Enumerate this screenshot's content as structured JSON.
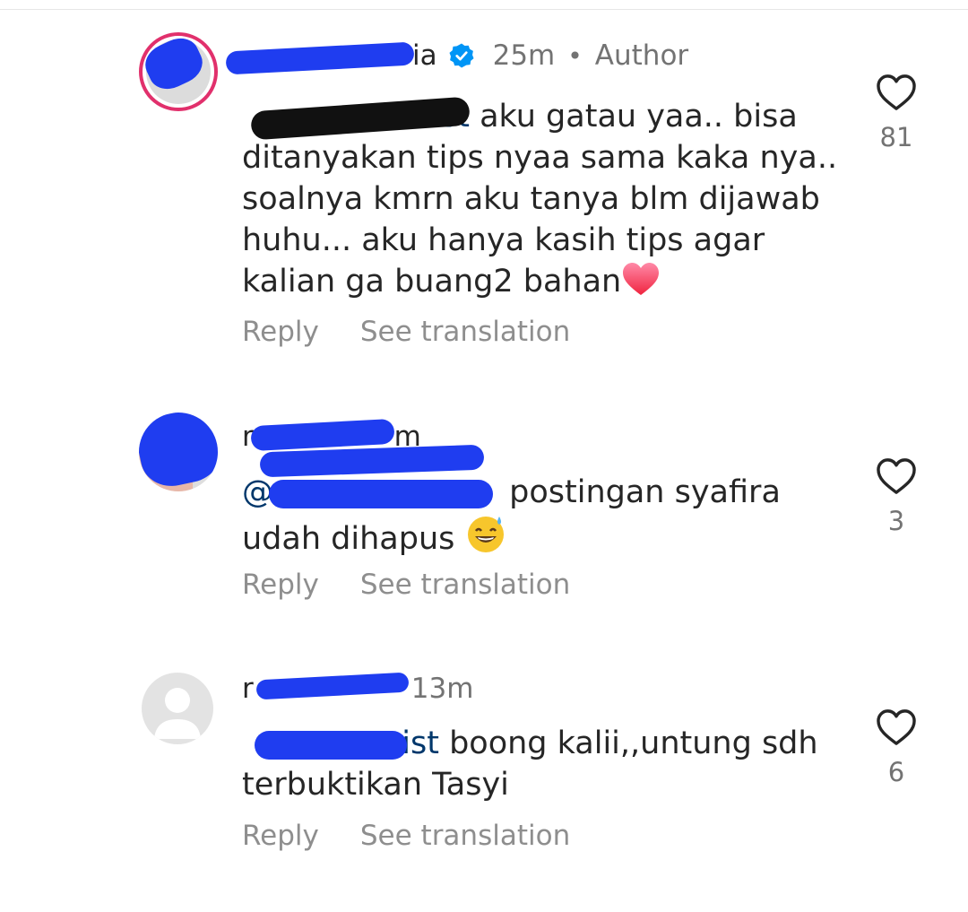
{
  "comments": [
    {
      "username_visible": "ia",
      "time": "25m",
      "separator": "•",
      "author_badge": "Author",
      "mention_visible": "st",
      "text": "aku gatau yaa.. bisa ditanyakan tips nyaa sama kaka nya.. soalnya kmrn aku tanya blm dijawab huhu... aku hanya kasih tips agar kalian ga buang2 bahan",
      "emoji": "red-heart",
      "reply_label": "Reply",
      "translate_label": "See translation",
      "like_count": "81"
    },
    {
      "username_visible": "n",
      "time": "m",
      "mention_visible": "@",
      "text": "postingan syafira udah dihapus",
      "emoji": "grinning-sweat",
      "reply_label": "Reply",
      "translate_label": "See translation",
      "like_count": "3"
    },
    {
      "username_visible": "r",
      "time": "13m",
      "mention_visible": "sist",
      "text": "boong kalii,,untung sdh terbuktikan Tasyi",
      "reply_label": "Reply",
      "translate_label": "See translation",
      "like_count": "6"
    }
  ],
  "colors": {
    "redaction": "#1f3df0",
    "verified": "#0095f6",
    "mention": "#00376b",
    "secondary": "#737373"
  }
}
